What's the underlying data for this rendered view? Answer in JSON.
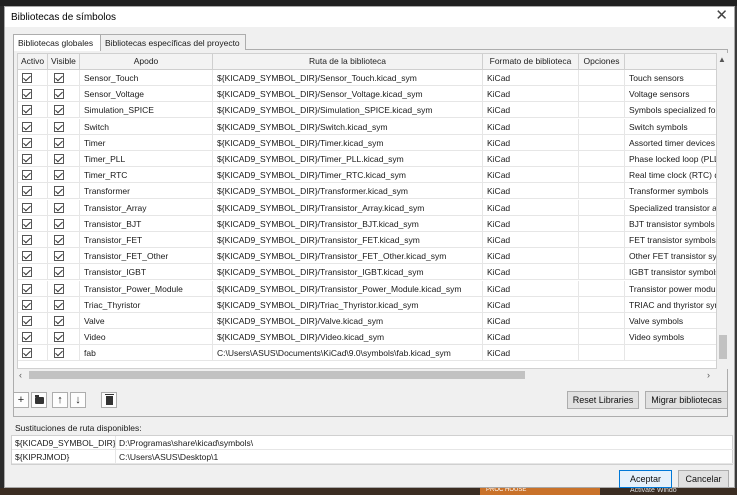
{
  "dialog": {
    "title": "Bibliotecas de símbolos",
    "tabs": [
      {
        "label": "Bibliotecas globales",
        "active": true
      },
      {
        "label": "Bibliotecas específicas del proyecto",
        "active": false
      }
    ]
  },
  "table": {
    "columns": [
      "Activo",
      "Visible",
      "Apodo",
      "Ruta de la biblioteca",
      "Formato de biblioteca",
      "Opciones",
      ""
    ],
    "rows": [
      {
        "active": true,
        "visible": true,
        "nickname": "Sensor_Touch",
        "path": "${KICAD9_SYMBOL_DIR}/Sensor_Touch.kicad_sym",
        "format": "KiCad",
        "options": "",
        "description": "Touch sensors"
      },
      {
        "active": true,
        "visible": true,
        "nickname": "Sensor_Voltage",
        "path": "${KICAD9_SYMBOL_DIR}/Sensor_Voltage.kicad_sym",
        "format": "KiCad",
        "options": "",
        "description": "Voltage sensors"
      },
      {
        "active": true,
        "visible": true,
        "nickname": "Simulation_SPICE",
        "path": "${KICAD9_SYMBOL_DIR}/Simulation_SPICE.kicad_sym",
        "format": "KiCad",
        "options": "",
        "description": "Symbols specialized for"
      },
      {
        "active": true,
        "visible": true,
        "nickname": "Switch",
        "path": "${KICAD9_SYMBOL_DIR}/Switch.kicad_sym",
        "format": "KiCad",
        "options": "",
        "description": "Switch symbols"
      },
      {
        "active": true,
        "visible": true,
        "nickname": "Timer",
        "path": "${KICAD9_SYMBOL_DIR}/Timer.kicad_sym",
        "format": "KiCad",
        "options": "",
        "description": "Assorted timer devices"
      },
      {
        "active": true,
        "visible": true,
        "nickname": "Timer_PLL",
        "path": "${KICAD9_SYMBOL_DIR}/Timer_PLL.kicad_sym",
        "format": "KiCad",
        "options": "",
        "description": "Phase locked loop (PLL)"
      },
      {
        "active": true,
        "visible": true,
        "nickname": "Timer_RTC",
        "path": "${KICAD9_SYMBOL_DIR}/Timer_RTC.kicad_sym",
        "format": "KiCad",
        "options": "",
        "description": "Real time clock (RTC) de"
      },
      {
        "active": true,
        "visible": true,
        "nickname": "Transformer",
        "path": "${KICAD9_SYMBOL_DIR}/Transformer.kicad_sym",
        "format": "KiCad",
        "options": "",
        "description": "Transformer symbols"
      },
      {
        "active": true,
        "visible": true,
        "nickname": "Transistor_Array",
        "path": "${KICAD9_SYMBOL_DIR}/Transistor_Array.kicad_sym",
        "format": "KiCad",
        "options": "",
        "description": "Specialized transistor arr"
      },
      {
        "active": true,
        "visible": true,
        "nickname": "Transistor_BJT",
        "path": "${KICAD9_SYMBOL_DIR}/Transistor_BJT.kicad_sym",
        "format": "KiCad",
        "options": "",
        "description": "BJT transistor symbols"
      },
      {
        "active": true,
        "visible": true,
        "nickname": "Transistor_FET",
        "path": "${KICAD9_SYMBOL_DIR}/Transistor_FET.kicad_sym",
        "format": "KiCad",
        "options": "",
        "description": "FET transistor symbols"
      },
      {
        "active": true,
        "visible": true,
        "nickname": "Transistor_FET_Other",
        "path": "${KICAD9_SYMBOL_DIR}/Transistor_FET_Other.kicad_sym",
        "format": "KiCad",
        "options": "",
        "description": "Other FET transistor symb"
      },
      {
        "active": true,
        "visible": true,
        "nickname": "Transistor_IGBT",
        "path": "${KICAD9_SYMBOL_DIR}/Transistor_IGBT.kicad_sym",
        "format": "KiCad",
        "options": "",
        "description": "IGBT transistor symbols"
      },
      {
        "active": true,
        "visible": true,
        "nickname": "Transistor_Power_Module",
        "path": "${KICAD9_SYMBOL_DIR}/Transistor_Power_Module.kicad_sym",
        "format": "KiCad",
        "options": "",
        "description": "Transistor power module"
      },
      {
        "active": true,
        "visible": true,
        "nickname": "Triac_Thyristor",
        "path": "${KICAD9_SYMBOL_DIR}/Triac_Thyristor.kicad_sym",
        "format": "KiCad",
        "options": "",
        "description": "TRIAC and thyristor symb"
      },
      {
        "active": true,
        "visible": true,
        "nickname": "Valve",
        "path": "${KICAD9_SYMBOL_DIR}/Valve.kicad_sym",
        "format": "KiCad",
        "options": "",
        "description": "Valve symbols"
      },
      {
        "active": true,
        "visible": true,
        "nickname": "Video",
        "path": "${KICAD9_SYMBOL_DIR}/Video.kicad_sym",
        "format": "KiCad",
        "options": "",
        "description": "Video symbols"
      },
      {
        "active": true,
        "visible": true,
        "nickname": "fab",
        "path": "C:\\Users\\ASUS\\Documents\\KiCad\\9.0\\symbols\\fab.kicad_sym",
        "format": "KiCad",
        "options": "",
        "description": ""
      }
    ]
  },
  "toolbar": {
    "icons": [
      "add-icon",
      "folder-icon",
      "move-up-icon",
      "move-down-icon",
      "trash-icon"
    ],
    "add_glyph": "+",
    "up_glyph": "↑",
    "down_glyph": "↓",
    "reset_label": "Reset Libraries",
    "migrate_label": "Migrar bibliotecas"
  },
  "substitutions": {
    "label": "Sustituciones de ruta disponibles:",
    "rows": [
      {
        "var": "${KICAD9_SYMBOL_DIR}",
        "value": "D:\\Programas\\share\\kicad\\symbols\\"
      },
      {
        "var": "${KIPRJMOD}",
        "value": "C:\\Users\\ASUS\\Desktop\\1"
      }
    ]
  },
  "footer": {
    "accept_label": "Aceptar",
    "cancel_label": "Cancelar"
  },
  "background": {
    "banner_text": "PROC HOUSE",
    "corner_text": "Activate Windo"
  },
  "colors": {
    "accent": "#0078d7",
    "dialog_bg": "#f0f0f0"
  }
}
